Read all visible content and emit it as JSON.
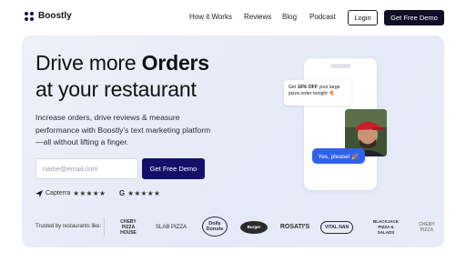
{
  "nav": {
    "logo_text": "Boostly",
    "links": [
      "How it Works",
      "Reviews",
      "Blog",
      "Podcast"
    ],
    "login_label": "Login",
    "demo_label": "Get Free Demo"
  },
  "hero": {
    "headline_line1_normal": "Drive more ",
    "headline_line1_bold": "Orders",
    "headline_line2": "at your restaurant",
    "subtext": "Increase orders, drive reviews & measure performance with Boostly's text marketing platform—all without lifting a finger.",
    "email_placeholder": "name@email.com",
    "demo_label": "Get Free Demo",
    "ratings": [
      {
        "source": "Capterra",
        "stars": "★★★★★",
        "icon": "capterra-icon"
      },
      {
        "source": "G",
        "stars": "★★★★★",
        "icon": "google-icon"
      }
    ]
  },
  "phone": {
    "message_1_prefix": "Get ",
    "message_1_bold": "10% OFF",
    "message_1_rest": " your large pizza order tonight 🍕",
    "message_2": "Yes, please! 🎉"
  },
  "trusted": {
    "label": "Trusted by restaurants like:",
    "brands": [
      "CHEBY PIZZA HOUSE",
      "SLAB PIZZA",
      "Dolly Donuts",
      "Burger",
      "ROSATI'S",
      "VITAL NAN",
      "BLACKJACK PIZZA & SALADS",
      "CHEBY PIZZA"
    ]
  },
  "colors": {
    "primary_dark": "#110f26",
    "cta_blue": "#14106a",
    "bubble_blue": "#2f62e8",
    "hero_bg": "#eef0f8"
  }
}
